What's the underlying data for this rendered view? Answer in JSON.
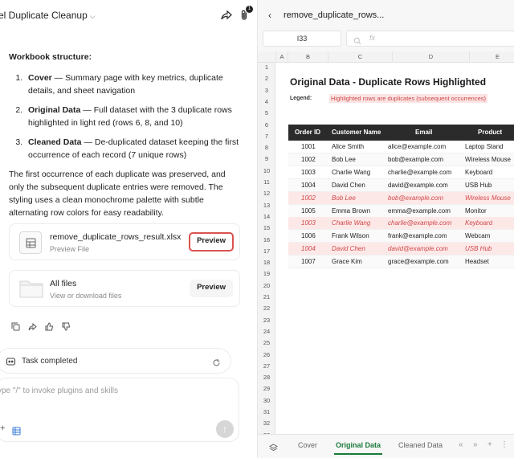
{
  "chat": {
    "title": "el Duplicate Cleanup",
    "notification_count": "1",
    "heading": "Workbook structure:",
    "structure": [
      {
        "name": "Cover",
        "desc": " — Summary page with key metrics, duplicate details, and sheet navigation"
      },
      {
        "name": "Original Data",
        "desc": " — Full dataset with the 3 duplicate rows highlighted in light red (rows 6, 8, and 10)"
      },
      {
        "name": "Cleaned Data",
        "desc": " — De-duplicated dataset keeping the first occurrence of each record (7 unique rows)"
      }
    ],
    "paragraph": "The first occurrence of each duplicate was preserved, and only the subsequent duplicate entries were removed. The styling uses a clean monochrome palette with subtle alternating row colors for easy readability.",
    "file_card": {
      "name": "remove_duplicate_rows_result.xlsx",
      "sub": "Preview File",
      "button": "Preview"
    },
    "files_card": {
      "name": "All files",
      "sub": "View or download files",
      "button": "Preview"
    },
    "task_status": "Task completed",
    "composer_placeholder": "ype \"/\" to invoke plugins and skills"
  },
  "preview": {
    "file_title": "remove_duplicate_rows...",
    "cell_ref": "I33",
    "fx_label": "fx",
    "columns": [
      "A",
      "B",
      "C",
      "D",
      "E"
    ],
    "row_numbers": [
      "1",
      "2",
      "3",
      "4",
      "5",
      "6",
      "7",
      "8",
      "9",
      "10",
      "11",
      "12",
      "13",
      "14",
      "15",
      "16",
      "17",
      "18",
      "19",
      "20",
      "21",
      "22",
      "23",
      "24",
      "25",
      "26",
      "27",
      "28",
      "29",
      "30",
      "31",
      "32",
      "33"
    ],
    "sheet_title": "Original Data  -  Duplicate Rows Highlighted",
    "legend_label": "Legend:",
    "legend_text": "Highlighted rows are duplicates (subsequent occurrences)",
    "headers": [
      "Order ID",
      "Customer Name",
      "Email",
      "Product"
    ],
    "rows": [
      {
        "id": "1001",
        "name": "Alice Smith",
        "email": "alice@example.com",
        "product": "Laptop Stand",
        "dup": false
      },
      {
        "id": "1002",
        "name": "Bob Lee",
        "email": "bob@example.com",
        "product": "Wireless Mouse",
        "dup": false
      },
      {
        "id": "1003",
        "name": "Charlie Wang",
        "email": "charlie@example.com",
        "product": "Keyboard",
        "dup": false
      },
      {
        "id": "1004",
        "name": "David Chen",
        "email": "david@example.com",
        "product": "USB Hub",
        "dup": false
      },
      {
        "id": "1002",
        "name": "Bob Lee",
        "email": "bob@example.com",
        "product": "Wireless Mouse",
        "dup": true
      },
      {
        "id": "1005",
        "name": "Emma Brown",
        "email": "emma@example.com",
        "product": "Monitor",
        "dup": false
      },
      {
        "id": "1003",
        "name": "Charlie Wang",
        "email": "charlie@example.com",
        "product": "Keyboard",
        "dup": true
      },
      {
        "id": "1006",
        "name": "Frank Wilson",
        "email": "frank@example.com",
        "product": "Webcam",
        "dup": false
      },
      {
        "id": "1004",
        "name": "David Chen",
        "email": "david@example.com",
        "product": "USB Hub",
        "dup": true
      },
      {
        "id": "1007",
        "name": "Grace Kim",
        "email": "grace@example.com",
        "product": "Headset",
        "dup": false
      }
    ],
    "tabs": [
      "Cover",
      "Original Data",
      "Cleaned Data"
    ],
    "active_tab": "Original Data"
  },
  "colors": {
    "accent": "#1a7a3a",
    "duplicate_text": "#d04848",
    "duplicate_bg": "#fde8e8",
    "header_bg": "#2b2b2b",
    "highlight_border": "#d9534f"
  }
}
